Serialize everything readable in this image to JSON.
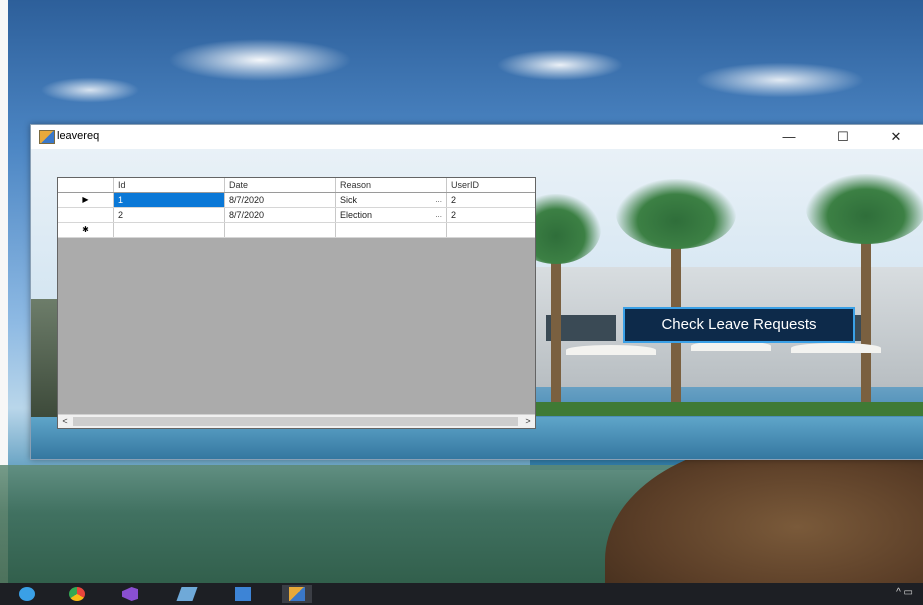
{
  "window": {
    "title": "leavereq",
    "controls": {
      "minimize": "—",
      "maximize": "☐",
      "close": "✕"
    }
  },
  "grid": {
    "columns": [
      "Id",
      "Date",
      "Reason",
      "UserID"
    ],
    "rows": [
      {
        "indicator": "▶",
        "id": "1",
        "date": "8/7/2020",
        "reason": "Sick",
        "userid": "2"
      },
      {
        "indicator": "",
        "id": "2",
        "date": "8/7/2020",
        "reason": "Election",
        "userid": "2"
      },
      {
        "indicator": "✱",
        "id": "",
        "date": "",
        "reason": "",
        "userid": ""
      }
    ],
    "combo_ellipsis": "...",
    "scroll_left": "<",
    "scroll_right": ">"
  },
  "button": {
    "label": "Check Leave Requests"
  },
  "colors": {
    "selected_row": "#0a78d7",
    "button_bg": "#0d2a4a",
    "button_border": "#3aa0e6",
    "taskbar": "#1d1f24"
  },
  "taskbar": {
    "icons": [
      "start-icon",
      "chrome-icon",
      "visual-studio-icon",
      "folder-icon",
      "photos-icon",
      "app-icon"
    ],
    "tray": "^ ▭"
  }
}
